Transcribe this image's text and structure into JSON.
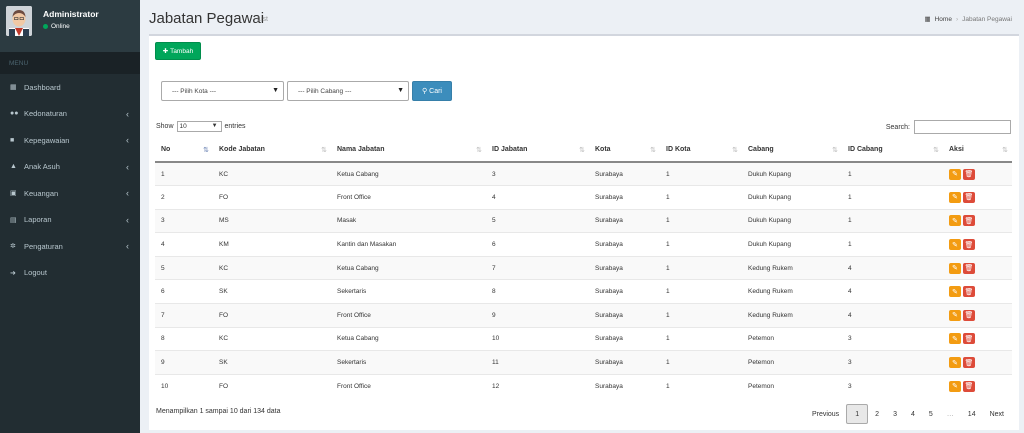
{
  "user": {
    "name": "Administrator",
    "status": "Online"
  },
  "menu_header": "MENU",
  "menu": [
    {
      "label": "Dashboard",
      "icon": "dashboard-icon",
      "has_children": false
    },
    {
      "label": "Kedonaturan",
      "icon": "users-icon",
      "has_children": true
    },
    {
      "label": "Kepegawaian",
      "icon": "briefcase-icon",
      "has_children": true
    },
    {
      "label": "Anak Asuh",
      "icon": "graduation-cap-icon",
      "has_children": true
    },
    {
      "label": "Keuangan",
      "icon": "money-icon",
      "has_children": true
    },
    {
      "label": "Laporan",
      "icon": "book-icon",
      "has_children": true
    },
    {
      "label": "Pengaturan",
      "icon": "gear-icon",
      "has_children": true
    },
    {
      "label": "Logout",
      "icon": "sign-out-icon",
      "has_children": false
    }
  ],
  "page": {
    "title": "Jabatan Pegawai",
    "subtitle": "List"
  },
  "breadcrumb": {
    "home": "Home",
    "current": "Jabatan Pegawai"
  },
  "toolbar": {
    "add_label": "Tambah"
  },
  "filters": {
    "kota_placeholder": "--- Pilih Kota ---",
    "cabang_placeholder": "--- Pilih Cabang ---",
    "search_label": "Cari"
  },
  "table_controls": {
    "show_label": "Show",
    "entries_value": "10",
    "entries_label": "entries",
    "search_label": "Search:"
  },
  "table": {
    "columns": [
      "No",
      "Kode Jabatan",
      "Nama Jabatan",
      "ID Jabatan",
      "Kota",
      "ID Kota",
      "Cabang",
      "ID Cabang",
      "Aksi"
    ],
    "rows": [
      [
        "1",
        "KC",
        "Ketua Cabang",
        "3",
        "Surabaya",
        "1",
        "Dukuh Kupang",
        "1"
      ],
      [
        "2",
        "FO",
        "Front Office",
        "4",
        "Surabaya",
        "1",
        "Dukuh Kupang",
        "1"
      ],
      [
        "3",
        "MS",
        "Masak",
        "5",
        "Surabaya",
        "1",
        "Dukuh Kupang",
        "1"
      ],
      [
        "4",
        "KM",
        "Kantin dan Masakan",
        "6",
        "Surabaya",
        "1",
        "Dukuh Kupang",
        "1"
      ],
      [
        "5",
        "KC",
        "Ketua Cabang",
        "7",
        "Surabaya",
        "1",
        "Kedung Rukem",
        "4"
      ],
      [
        "6",
        "SK",
        "Sekertaris",
        "8",
        "Surabaya",
        "1",
        "Kedung Rukem",
        "4"
      ],
      [
        "7",
        "FO",
        "Front Office",
        "9",
        "Surabaya",
        "1",
        "Kedung Rukem",
        "4"
      ],
      [
        "8",
        "KC",
        "Ketua Cabang",
        "10",
        "Surabaya",
        "1",
        "Petemon",
        "3"
      ],
      [
        "9",
        "SK",
        "Sekertaris",
        "11",
        "Surabaya",
        "1",
        "Petemon",
        "3"
      ],
      [
        "10",
        "FO",
        "Front Office",
        "12",
        "Surabaya",
        "1",
        "Petemon",
        "3"
      ]
    ]
  },
  "info_text": "Menampilkan 1 sampai 10 dari 134 data",
  "pagination": [
    "Previous",
    "1",
    "2",
    "3",
    "4",
    "5",
    "…",
    "14",
    "Next"
  ],
  "colors": {
    "sidebar": "#222d32",
    "add_button": "#00a65a",
    "search_button": "#3c8dbc",
    "edit_button": "#f39c12",
    "delete_button": "#dd4b39"
  }
}
